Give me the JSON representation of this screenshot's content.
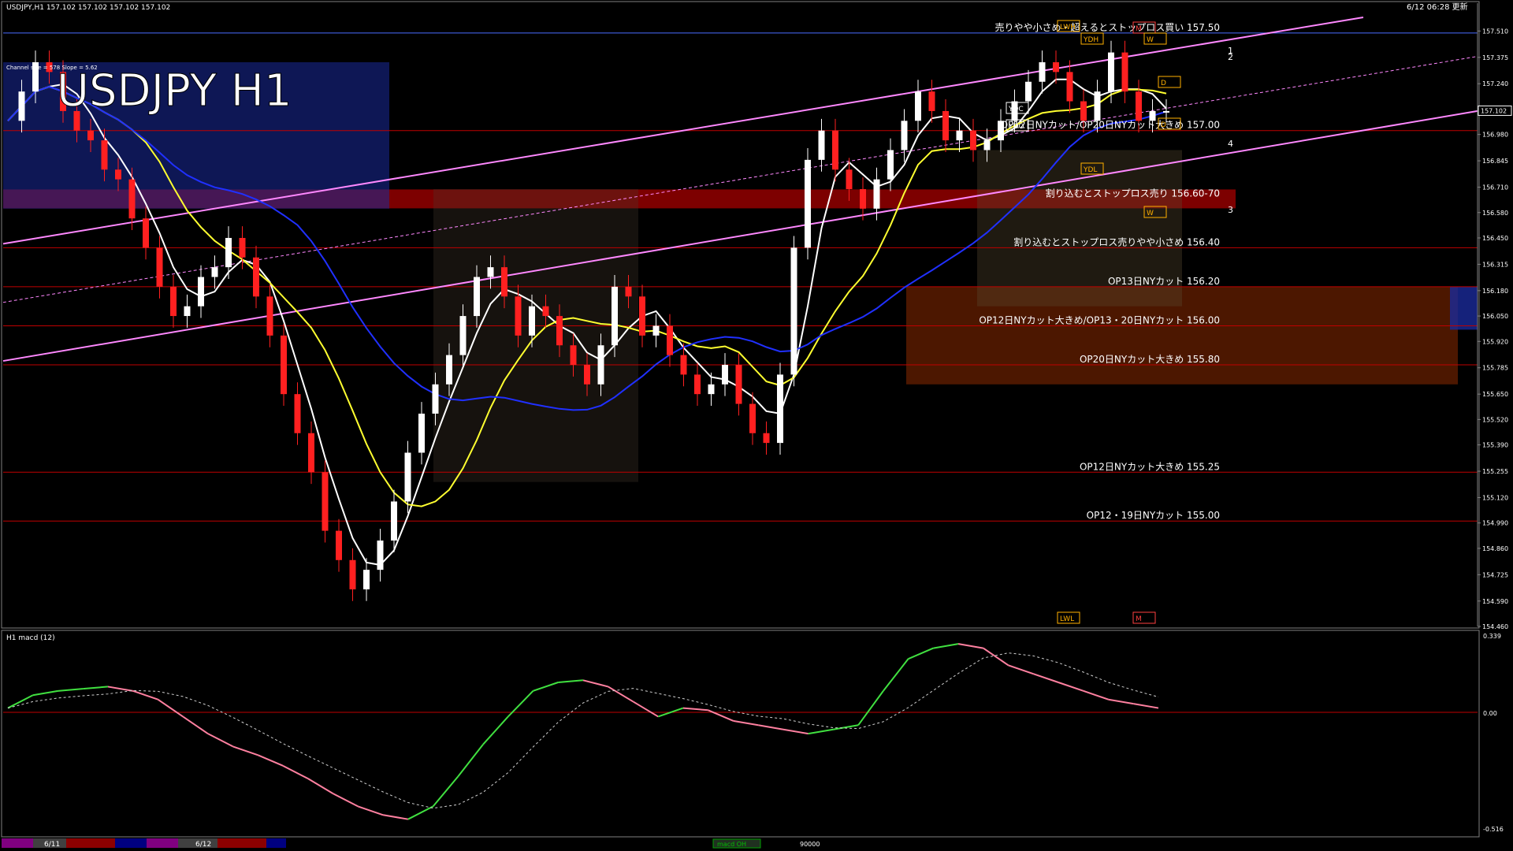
{
  "header": {
    "symbol_info": "USDJPY,H1  157.102 157.102 157.102 157.102",
    "timestamp": "6/12 06:28 更新",
    "big_title": "USDJPY H1",
    "channel_info": "Channel size = 578 Slope = 5.62"
  },
  "price_axis": {
    "min": 154.46,
    "max": 157.58,
    "ticks": [
      "157.510",
      "157.375",
      "157.240",
      "157.105",
      "156.980",
      "156.845",
      "156.710",
      "156.580",
      "156.450",
      "156.315",
      "156.180",
      "156.050",
      "155.920",
      "155.785",
      "155.650",
      "155.520",
      "155.390",
      "155.255",
      "155.120",
      "154.990",
      "154.860",
      "154.725",
      "154.590",
      "154.460"
    ],
    "current_price": "157.102"
  },
  "levels": [
    {
      "price": 157.5,
      "label": "売りやや小さめ・超えるとストップロス買い 157.50",
      "color": "#4a6cff"
    },
    {
      "price": 157.0,
      "label": "OP12日NYカット/OP20日NYカット大きめ 157.00",
      "color": "#c00000"
    },
    {
      "price": 156.65,
      "label": "割り込むとストップロス売り 156.60-70",
      "color": "#8b0000",
      "band": true
    },
    {
      "price": 156.4,
      "label": "割り込むとストップロス売りやや小さめ 156.40",
      "color": "#c00000"
    },
    {
      "price": 156.2,
      "label": "OP13日NYカット 156.20",
      "color": "#c00000"
    },
    {
      "price": 156.0,
      "label": "OP12日NYカット大きめ/OP13・20日NYカット 156.00",
      "color": "#c00000"
    },
    {
      "price": 155.8,
      "label": "OP20日NYカット大きめ 155.80",
      "color": "#c00000"
    },
    {
      "price": 155.25,
      "label": "OP12日NYカット大きめ 155.25",
      "color": "#c00000"
    },
    {
      "price": 155.0,
      "label": "OP12・19日NYカット 155.00",
      "color": "#c00000"
    }
  ],
  "markers": {
    "lwh": "LWH",
    "ydh": "YDH",
    "ydc": "YDC",
    "ydo": "YDO",
    "ydl": "YDL",
    "lwl": "LWL",
    "m": "M",
    "w": "W",
    "d": "D",
    "channel_nums": [
      "1",
      "2",
      "3",
      "4"
    ]
  },
  "macd": {
    "title": "H1  macd (12)",
    "axis_top": "0.339",
    "axis_zero": "0.00",
    "axis_bottom": "-0.516"
  },
  "time_axis": {
    "dates": [
      "6/11",
      "6/12"
    ],
    "tab": "macd OH",
    "volume": "90000"
  },
  "colors": {
    "bull_candle": "#ffffff",
    "bear_candle": "#ff2020",
    "ma_fast": "#ffffff",
    "ma_mid": "#ffff30",
    "ma_slow": "#2030ff",
    "channel": "#ff88ff",
    "macd_up": "#40e040",
    "macd_down": "#ff80a0"
  },
  "chart_data": {
    "type": "candlestick",
    "title": "USDJPY H1",
    "ylim": [
      154.46,
      157.58
    ],
    "series": [
      {
        "name": "price",
        "values": [
          157.05,
          157.2,
          157.35,
          157.3,
          157.1,
          157.0,
          156.95,
          156.8,
          156.75,
          156.55,
          156.4,
          156.2,
          156.05,
          156.1,
          156.25,
          156.3,
          156.45,
          156.35,
          156.15,
          155.95,
          155.65,
          155.45,
          155.25,
          154.95,
          154.8,
          154.65,
          154.75,
          154.9,
          155.1,
          155.35,
          155.55,
          155.7,
          155.85,
          156.05,
          156.25,
          156.3,
          156.15,
          155.95,
          156.1,
          156.05,
          155.9,
          155.8,
          155.7,
          155.9,
          156.2,
          156.15,
          155.95,
          156.0,
          155.85,
          155.75,
          155.65,
          155.7,
          155.8,
          155.6,
          155.45,
          155.4,
          155.75,
          156.4,
          156.85,
          157.0,
          156.8,
          156.7,
          156.6,
          156.75,
          156.9,
          157.05,
          157.2,
          157.1,
          156.95,
          157.0,
          156.9,
          156.95,
          157.05,
          157.15,
          157.25,
          157.35,
          157.3,
          157.15,
          157.05,
          157.2,
          157.4,
          157.2,
          157.05,
          157.1,
          157.1
        ]
      }
    ]
  }
}
